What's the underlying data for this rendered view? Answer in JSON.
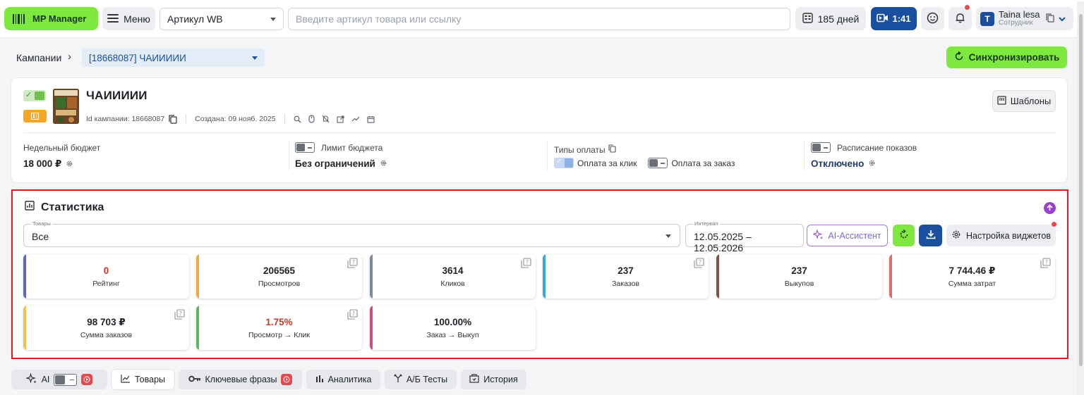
{
  "topbar": {
    "logo": "MP Manager",
    "menu": "Меню",
    "article_select": "Артикул WB",
    "search_placeholder": "Введите артикул товара или ссылку",
    "days": "185 дней",
    "timer": "1:41",
    "user_initial": "T",
    "user_name": "Taina lesa",
    "user_role": "Сотрудник"
  },
  "breadcrumb": {
    "root": "Кампании",
    "campaign": "[18668087] ЧАИИИИИ"
  },
  "sync_button": "Синхронизировать",
  "campaign": {
    "title": "ЧАИИИИИ",
    "id_text": "Id кампании: 18668087",
    "created_text": "Создана: 09 нояб. 2025",
    "templates_button": "Шаблоны",
    "weekly_budget_label": "Недельный бюджет",
    "weekly_budget_value": "18 000 ₽",
    "budget_limit_label": "Лимит бюджета",
    "budget_limit_value": "Без ограничений",
    "payment_types_label": "Типы оплаты",
    "pay_click": "Оплата за клик",
    "pay_order": "Оплата за заказ",
    "schedule_label": "Расписание показов",
    "schedule_value": "Отключено"
  },
  "stats": {
    "title": "Статистика",
    "goods_label": "Товары",
    "goods_value": "Все",
    "interval_label": "Интервал",
    "interval_value": "12.05.2025 – 12.05.2026",
    "ai_button": "AI-Ассистент",
    "widgets_button": "Настройка виджетов",
    "metrics": [
      {
        "value": "0",
        "label": "Рейтинг",
        "color": "#5b6cbf",
        "value_color": "#c0392b"
      },
      {
        "value": "206565",
        "label": "Просмотров",
        "color": "#f2a93b",
        "value_color": "#1f2329"
      },
      {
        "value": "3614",
        "label": "Кликов",
        "color": "#7d8a96",
        "value_color": "#1f2329"
      },
      {
        "value": "237",
        "label": "Заказов",
        "color": "#3aa6e0",
        "value_color": "#1f2329"
      },
      {
        "value": "237",
        "label": "Выкупов",
        "color": "#7b5548",
        "value_color": "#1f2329"
      },
      {
        "value": "7 744.46 ₽",
        "label": "Сумма затрат",
        "color": "#e06b6b",
        "value_color": "#1f2329"
      },
      {
        "value": "98 703 ₽",
        "label": "Сумма заказов",
        "color": "#f5c04a",
        "value_color": "#1f2329"
      },
      {
        "value": "1.75%",
        "label": "Просмотр → Клик",
        "color": "#5fb461",
        "value_color": "#c0392b"
      },
      {
        "value": "100.00%",
        "label": "Заказ → Выкуп",
        "color": "#d64b7d",
        "value_color": "#1f2329"
      }
    ]
  },
  "tabs": {
    "ai": "AI",
    "goods": "Товары",
    "keywords": "Ключевые фразы",
    "analytics": "Аналитика",
    "ab": "А/Б Тесты",
    "history": "История"
  }
}
